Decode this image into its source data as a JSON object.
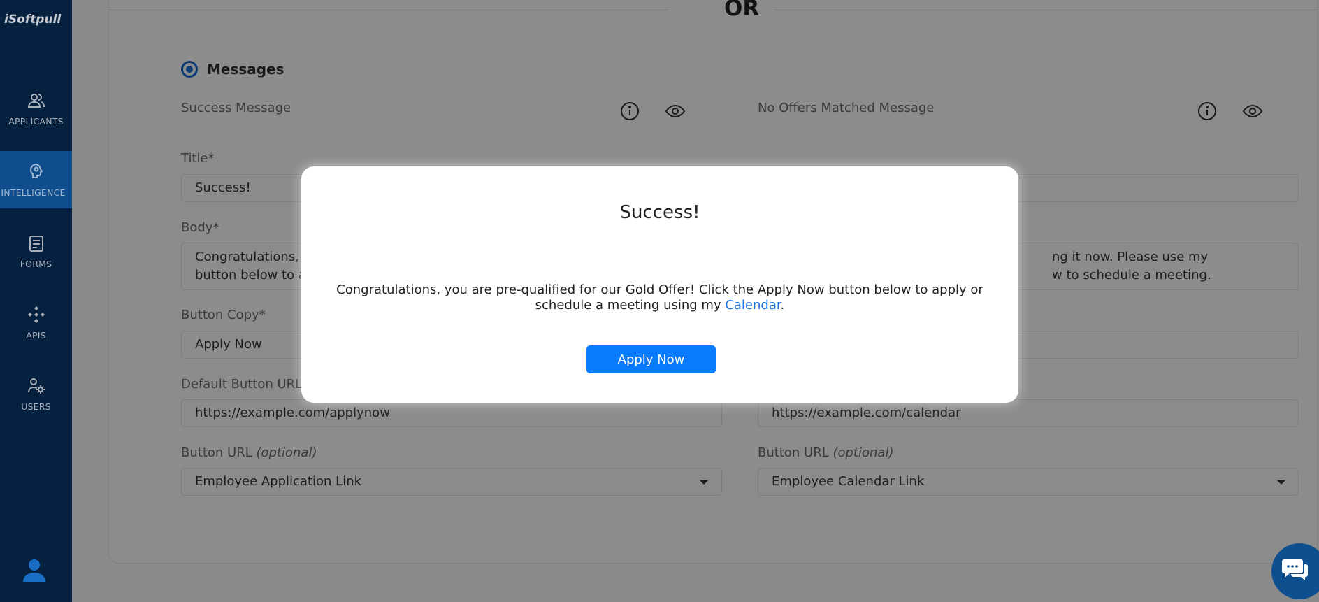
{
  "app": {
    "logo": "iSoftpull"
  },
  "sidebar": {
    "items": [
      {
        "label": "APPLICANTS",
        "icon": "users-icon"
      },
      {
        "label": "INTELLIGENCE",
        "icon": "brain-icon",
        "active": true
      },
      {
        "label": "FORMS",
        "icon": "form-icon"
      },
      {
        "label": "APIS",
        "icon": "api-icon"
      },
      {
        "label": "USERS",
        "icon": "user-gear-icon"
      }
    ]
  },
  "main": {
    "divider_text": "OR",
    "section": {
      "title": "Messages",
      "selected": true
    },
    "success": {
      "heading": "Success Message",
      "title_label": "Title*",
      "title_value": "Success!",
      "body_label": "Body*",
      "body_value": "Congratulations, you are pre-qualified for our Gold Offer! Click the Apply Now button below to apply or schedule a meeting using my Calendar.",
      "button_copy_label": "Button Copy*",
      "button_copy_value": "Apply Now",
      "default_url_label": "Default Button URL*",
      "default_url_value": "https://example.com/applynow",
      "button_url_label": "Button URL",
      "button_url_optional": "(optional)",
      "button_url_value": "Employee Application Link"
    },
    "no_offers": {
      "heading": "No Offers Matched Message",
      "body_visible_line1": "ng it now. Please use my",
      "body_visible_line2": "w to schedule a meeting.",
      "default_url_value": "https://example.com/calendar",
      "button_url_label": "Button URL",
      "button_url_optional": "(optional)",
      "button_url_value": "Employee Calendar Link"
    }
  },
  "modal": {
    "title": "Success!",
    "body_text": "Congratulations, you are pre-qualified for our Gold Offer! Click the Apply Now button below to apply or schedule a meeting using my ",
    "body_link": "Calendar",
    "body_end": ".",
    "button_label": "Apply Now"
  },
  "colors": {
    "sidebar_bg": "#06213f",
    "sidebar_active": "#0f4d8c",
    "primary_button": "#0a7bff",
    "link": "#1a73e8",
    "overlay": "#8a8a8a"
  }
}
